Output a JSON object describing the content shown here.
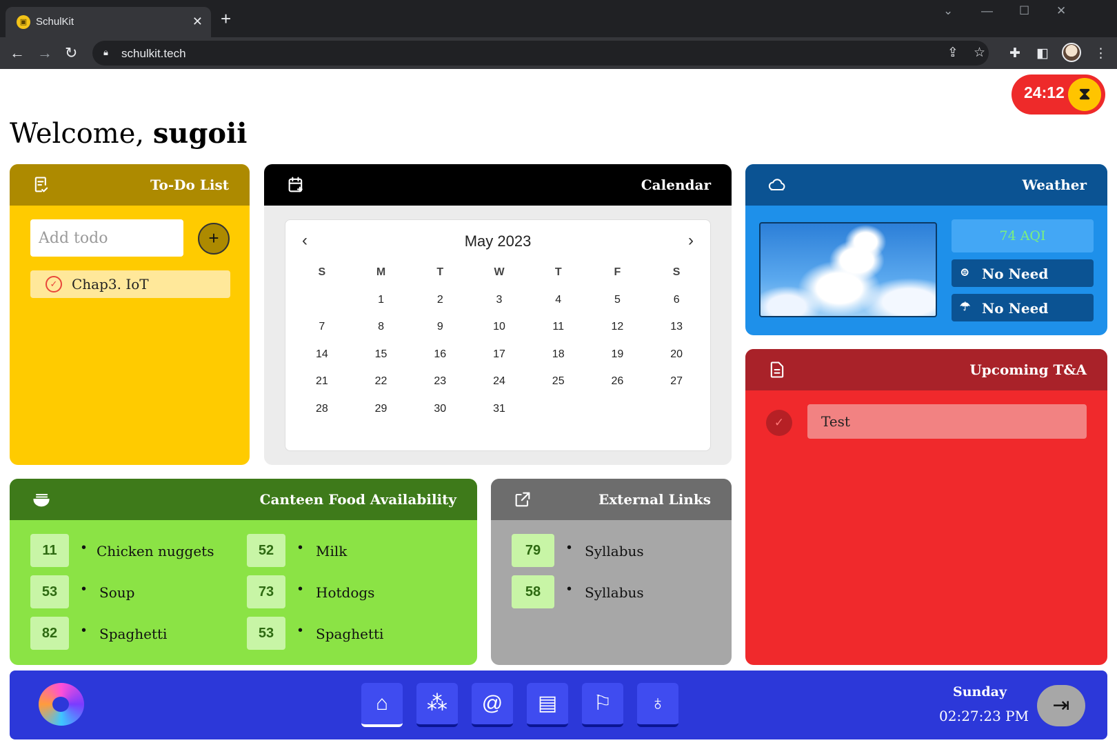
{
  "browser": {
    "tab_title": "SchulKit",
    "tab_close": "✕",
    "new_tab": "+",
    "url": "schulkit.tech"
  },
  "timer": {
    "value": "24:12",
    "icon": "hourglass-icon"
  },
  "welcome": {
    "greeting": "Welcome,",
    "user": "sugoii"
  },
  "todo": {
    "title": "To-Do List",
    "input_placeholder": "Add todo",
    "add_label": "+",
    "items": [
      {
        "text": "Chap3. IoT"
      }
    ]
  },
  "calendar": {
    "title": "Calendar",
    "month": "May 2023",
    "weekdays": [
      "S",
      "M",
      "T",
      "W",
      "T",
      "F",
      "S"
    ],
    "start_weekday": 1,
    "days_in_month": 31
  },
  "weather": {
    "title": "Weather",
    "aqi": "74 AQI",
    "umbrella": "No Need",
    "mask": "No Need"
  },
  "tna": {
    "title": "Upcoming T&A",
    "items": [
      {
        "text": "Test"
      }
    ]
  },
  "canteen": {
    "title": "Canteen Food Availability",
    "items": [
      {
        "count": "11",
        "name": "Chicken nuggets"
      },
      {
        "count": "53",
        "name": "Soup"
      },
      {
        "count": "82",
        "name": "Spaghetti"
      },
      {
        "count": "52",
        "name": "Milk"
      },
      {
        "count": "73",
        "name": "Hotdogs"
      },
      {
        "count": "53",
        "name": "Spaghetti"
      }
    ]
  },
  "external": {
    "title": "External Links",
    "items": [
      {
        "count": "79",
        "name": "Syllabus"
      },
      {
        "count": "58",
        "name": "Syllabus"
      }
    ]
  },
  "footer": {
    "day": "Sunday",
    "time": "02:27:23 PM",
    "nav_icons": [
      "home-icon",
      "pointer-click-icon",
      "snail-icon",
      "clipboard-icon",
      "flag-icon",
      "bomb-icon"
    ],
    "active_nav": "home-icon"
  },
  "colors": {
    "todo": "#ffcb00",
    "todo_head": "#ad8a00",
    "calendar_head": "#000000",
    "weather": "#1e90ea",
    "weather_head": "#0b5393",
    "tna": "#f0292c",
    "tna_head": "#a92229",
    "canteen": "#8be345",
    "canteen_head": "#3e7a1a",
    "external": "#a7a7a7",
    "external_head": "#6d6d6d",
    "bottombar": "#2c38d9",
    "timer": "#ee2a2a"
  }
}
